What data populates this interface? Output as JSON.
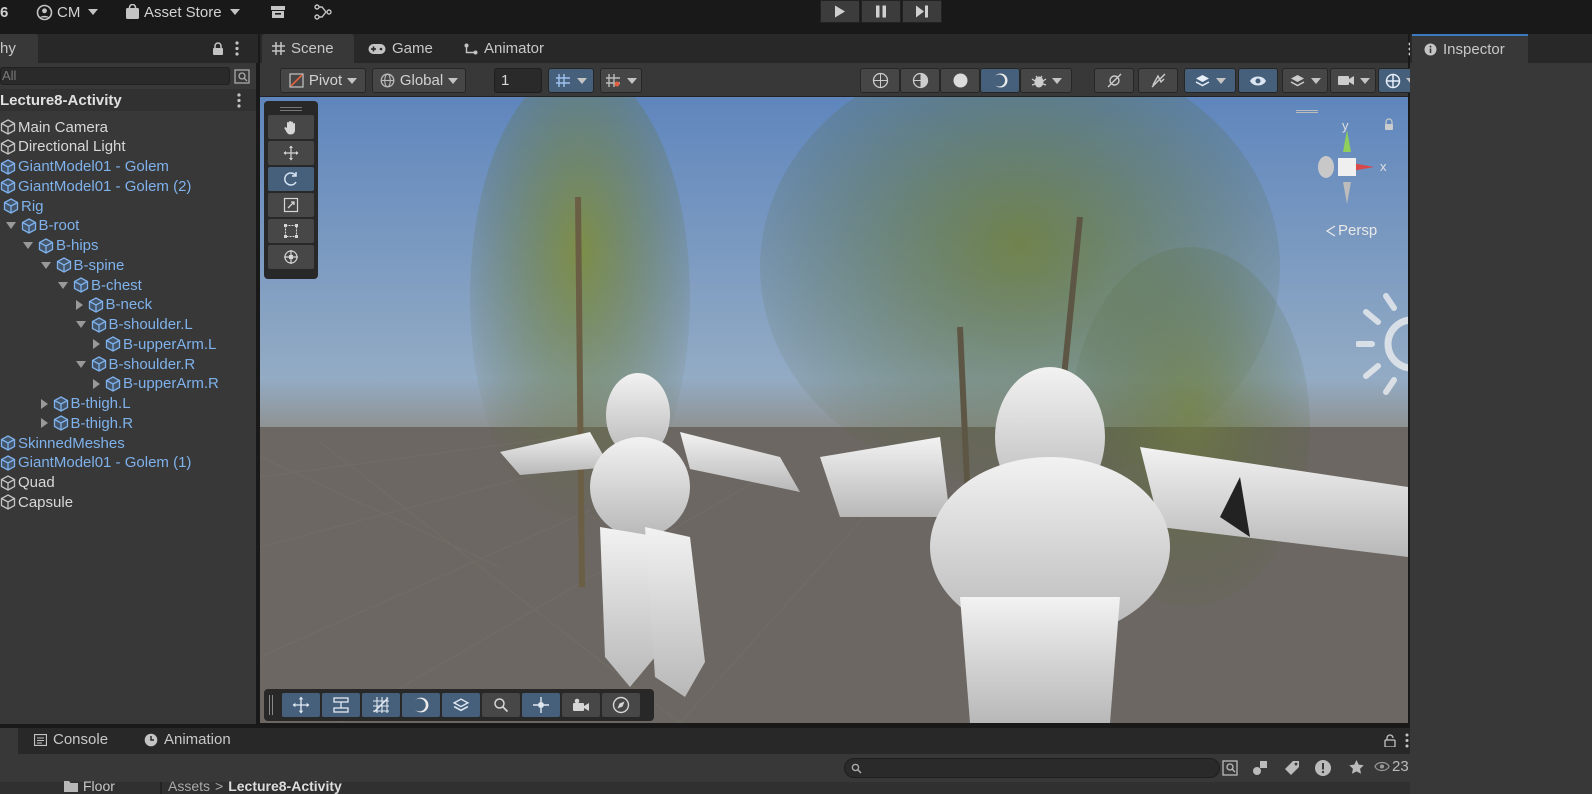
{
  "topbar": {
    "version_fragment": "6",
    "account": "CM",
    "asset_store": "Asset Store"
  },
  "tabs": {
    "hierarchy": "hy",
    "scene": "Scene",
    "game": "Game",
    "animator": "Animator",
    "inspector": "Inspector",
    "console": "Console",
    "animation": "Animation"
  },
  "hierarchy": {
    "search_placeholder": "All",
    "scene_name": "Lecture8-Activity",
    "rows": [
      {
        "label": "Main Camera",
        "depth": 0,
        "expand": "none",
        "prefab": false
      },
      {
        "label": "Directional Light",
        "depth": 0,
        "expand": "none",
        "prefab": false
      },
      {
        "label": "GiantModel01 - Golem",
        "depth": 0,
        "expand": "none",
        "prefab": true
      },
      {
        "label": "GiantModel01 - Golem (2)",
        "depth": 0,
        "expand": "none",
        "prefab": true
      },
      {
        "label": "Rig",
        "depth": 0,
        "expand": "down",
        "prefab": true
      },
      {
        "label": "B-root",
        "depth": 1,
        "expand": "down",
        "prefab": true
      },
      {
        "label": "B-hips",
        "depth": 2,
        "expand": "down",
        "prefab": true
      },
      {
        "label": "B-spine",
        "depth": 3,
        "expand": "down",
        "prefab": true
      },
      {
        "label": "B-chest",
        "depth": 4,
        "expand": "down",
        "prefab": true
      },
      {
        "label": "B-neck",
        "depth": 5,
        "expand": "right",
        "prefab": true
      },
      {
        "label": "B-shoulder.L",
        "depth": 5,
        "expand": "down",
        "prefab": true
      },
      {
        "label": "B-upperArm.L",
        "depth": 6,
        "expand": "right",
        "prefab": true
      },
      {
        "label": "B-shoulder.R",
        "depth": 5,
        "expand": "down",
        "prefab": true
      },
      {
        "label": "B-upperArm.R",
        "depth": 6,
        "expand": "right",
        "prefab": true
      },
      {
        "label": "B-thigh.L",
        "depth": 3,
        "expand": "right",
        "prefab": true
      },
      {
        "label": "B-thigh.R",
        "depth": 3,
        "expand": "right",
        "prefab": true
      },
      {
        "label": "SkinnedMeshes",
        "depth": 0,
        "expand": "right",
        "prefab": true
      },
      {
        "label": "GiantModel01 - Golem (1)",
        "depth": 0,
        "expand": "none",
        "prefab": true
      },
      {
        "label": "Quad",
        "depth": 0,
        "expand": "none",
        "prefab": false
      },
      {
        "label": "Capsule",
        "depth": 0,
        "expand": "none",
        "prefab": false
      }
    ]
  },
  "scene_toolbar": {
    "pivot": "Pivot",
    "global": "Global",
    "grid_value": "1"
  },
  "viewport": {
    "persp_label": "Persp",
    "axis_y": "y",
    "axis_x": "x"
  },
  "bottom": {
    "folder": "Floor",
    "breadcrumb_root": "Assets",
    "breadcrumb_sep": ">",
    "breadcrumb_current": "Lecture8-Activity",
    "hidden_count": "23"
  },
  "colors": {
    "accent": "#46607c",
    "prefab_text": "#7fb2ec",
    "panel": "#383838",
    "tabbar": "#282828"
  }
}
